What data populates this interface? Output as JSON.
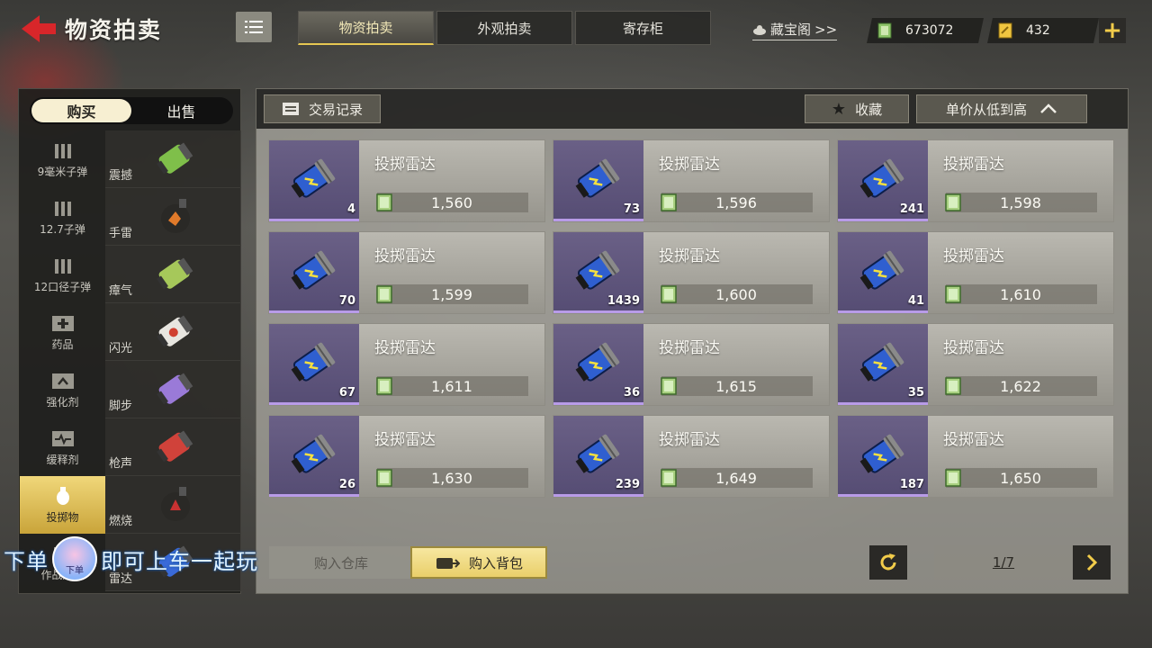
{
  "header": {
    "title": "物资拍卖",
    "tabs": [
      {
        "label": "物资拍卖",
        "active": true
      },
      {
        "label": "外观拍卖",
        "active": false
      },
      {
        "label": "寄存柜",
        "active": false
      }
    ],
    "treasure_label": "藏宝阁",
    "treasure_arrow": ">>",
    "currency1": "673072",
    "currency2": "432",
    "plus": "+",
    "accent": "#e6c752"
  },
  "left": {
    "mode_tabs": [
      {
        "label": "购买",
        "active": true
      },
      {
        "label": "出售",
        "active": false
      }
    ],
    "categories": [
      {
        "label": "9毫米子弹",
        "icon": "bullets-icon"
      },
      {
        "label": "12.7子弹",
        "icon": "bullets-icon"
      },
      {
        "label": "12口径子弹",
        "icon": "bullets-icon"
      },
      {
        "label": "药品",
        "icon": "medkit-icon"
      },
      {
        "label": "强化剂",
        "icon": "enhancer-icon"
      },
      {
        "label": "缓释剂",
        "icon": "slow-release-icon"
      },
      {
        "label": "投掷物",
        "icon": "grenade-icon",
        "active": true
      },
      {
        "label": "作战道具",
        "icon": "gear-icon"
      }
    ],
    "subcategories": [
      {
        "label": "震撼",
        "color": "#7fbf4a"
      },
      {
        "label": "手雷",
        "color": "#e07a2a"
      },
      {
        "label": "瘴气",
        "color": "#a6c85a"
      },
      {
        "label": "闪光",
        "color": "#e8e6e0"
      },
      {
        "label": "脚步",
        "color": "#9a7ad8"
      },
      {
        "label": "枪声",
        "color": "#d0423a"
      },
      {
        "label": "燃烧",
        "color": "#c83232"
      },
      {
        "label": "雷达",
        "color": "#3a6ad8"
      }
    ]
  },
  "main": {
    "records_label": "交易记录",
    "favorite_label": "收藏",
    "sort_label": "单价从低到高",
    "items": [
      {
        "name": "投掷雷达",
        "qty": "4",
        "price": "1,560"
      },
      {
        "name": "投掷雷达",
        "qty": "73",
        "price": "1,596"
      },
      {
        "name": "投掷雷达",
        "qty": "241",
        "price": "1,598"
      },
      {
        "name": "投掷雷达",
        "qty": "70",
        "price": "1,599"
      },
      {
        "name": "投掷雷达",
        "qty": "1439",
        "price": "1,600"
      },
      {
        "name": "投掷雷达",
        "qty": "41",
        "price": "1,610"
      },
      {
        "name": "投掷雷达",
        "qty": "67",
        "price": "1,611"
      },
      {
        "name": "投掷雷达",
        "qty": "36",
        "price": "1,615"
      },
      {
        "name": "投掷雷达",
        "qty": "35",
        "price": "1,622"
      },
      {
        "name": "投掷雷达",
        "qty": "26",
        "price": "1,630"
      },
      {
        "name": "投掷雷达",
        "qty": "239",
        "price": "1,649"
      },
      {
        "name": "投掷雷达",
        "qty": "187",
        "price": "1,650"
      }
    ],
    "buy_warehouse_label": "购入仓库",
    "buy_bag_label": "购入背包",
    "page": "1/7"
  },
  "overlay": {
    "text_left": "下单",
    "avatar_label": "下单",
    "text_right": "即可上车一起玩"
  }
}
